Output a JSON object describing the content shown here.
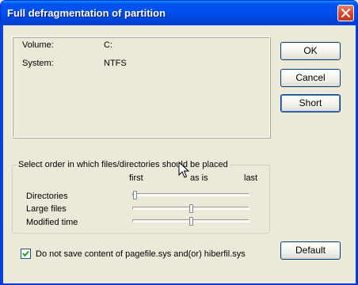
{
  "window": {
    "title": "Full defragmentation of partition"
  },
  "info": {
    "volume_label": "Volume:",
    "volume_value": "C:",
    "system_label": "System:",
    "system_value": "NTFS"
  },
  "buttons": {
    "ok": "OK",
    "cancel": "Cancel",
    "short": "Short",
    "default": "Default"
  },
  "placement": {
    "caption": "Select order in which files/directories should be placed",
    "col_first": "first",
    "col_as_is": "as is",
    "col_last": "last",
    "rows": [
      {
        "label": "Directories",
        "position_fraction": 0.0
      },
      {
        "label": "Large files",
        "position_fraction": 0.5
      },
      {
        "label": "Modified time",
        "position_fraction": 0.5
      }
    ]
  },
  "options": {
    "pagefile_label": "Do not save content of pagefile.sys and(or) hiberfil.sys",
    "pagefile_checked": true
  },
  "icons": {
    "close": "close-icon",
    "checkmark": "checkmark-icon",
    "cursor": "mouse-pointer-icon"
  },
  "colors": {
    "titlebar": "#0050ee",
    "close_button": "#d8462a",
    "dialog_background": "#ece9d8"
  }
}
